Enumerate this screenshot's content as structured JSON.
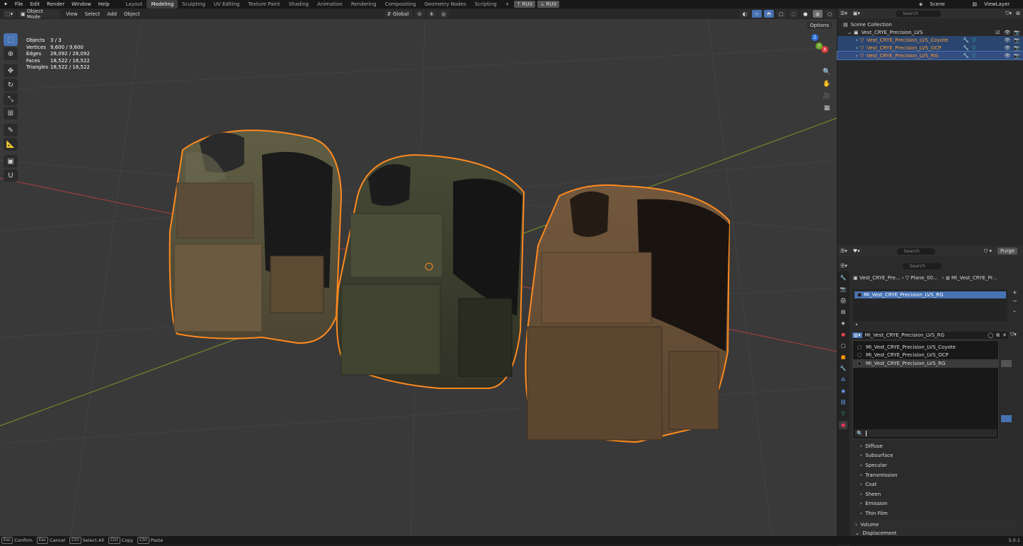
{
  "topbar": {
    "menus": [
      "File",
      "Edit",
      "Render",
      "Window",
      "Help"
    ],
    "workspaces": [
      "Layout",
      "Modeling",
      "Sculpting",
      "UV Editing",
      "Texture Paint",
      "Shading",
      "Animation",
      "Rendering",
      "Compositing",
      "Geometry Nodes",
      "Scripting"
    ],
    "active_workspace": "Modeling",
    "ruv1": "RUV",
    "ruv2": "RUV",
    "scene": "Scene",
    "view_layer": "ViewLayer"
  },
  "viewport_header": {
    "mode": "Object Mode",
    "menus": [
      "View",
      "Select",
      "Add",
      "Object"
    ],
    "transform": "Global",
    "options": "Options"
  },
  "stats": [
    {
      "label": "Objects",
      "value": "3 / 3"
    },
    {
      "label": "Vertices",
      "value": "9,600 / 9,600"
    },
    {
      "label": "Edges",
      "value": "28,092 / 28,092"
    },
    {
      "label": "Faces",
      "value": "18,522 / 18,522"
    },
    {
      "label": "Triangles",
      "value": "18,522 / 18,522"
    }
  ],
  "gizmo": {
    "x": "X",
    "y": "Y",
    "z": "Z"
  },
  "outliner": {
    "search_placeholder": "Search",
    "root": "Scene Collection",
    "collection": "Vest_CRYE_Precision_LVS",
    "objects": [
      "Vest_CRYE_Precision_LVS_Coyote",
      "Vest_CRYE_Precision_LVS_OCP",
      "Vest_CRYE_Precision_LVS_RG"
    ]
  },
  "second_header": {
    "search_placeholder": "Search",
    "purge": "Purge"
  },
  "properties": {
    "search_placeholder": "Search",
    "breadcrumb": [
      "Vest_CRYE_Pre...",
      "Plane_00...",
      "MI_Vest_CRYE_Pr..."
    ],
    "slot": "MI_Vest_CRYE_Precision_LVS_RG",
    "material_field": "MI_Vest_CRYE_Precision_LVS_RG",
    "dropdown_items": [
      "MI_Vest_CRYE_Precision_LVS_Coyote",
      "MI_Vest_CRYE_Precision_LVS_OCP",
      "MI_Vest_CRYE_Precision_LVS_RG"
    ],
    "sections": [
      "Diffuse",
      "Subsurface",
      "Specular",
      "Transmission",
      "Coat",
      "Sheen",
      "Emission",
      "Thin Film"
    ],
    "panels": [
      "Volume",
      "Displacement"
    ]
  },
  "statusbar": {
    "items": [
      {
        "key": "Esc",
        "label": "Confirm"
      },
      {
        "key": "Esc",
        "label": "Cancel"
      },
      {
        "key": "Ctrl",
        "label": "Select All"
      },
      {
        "key": "Ctrl",
        "label": "Copy"
      },
      {
        "key": "Ctrl",
        "label": "Paste"
      }
    ],
    "version": "5.0.1"
  },
  "colors": {
    "accent": "#4772b3",
    "selection": "#ff8a1f",
    "vest_ocp": "#6b6b4e",
    "vest_green": "#3d4130",
    "vest_brown": "#6e5238"
  }
}
